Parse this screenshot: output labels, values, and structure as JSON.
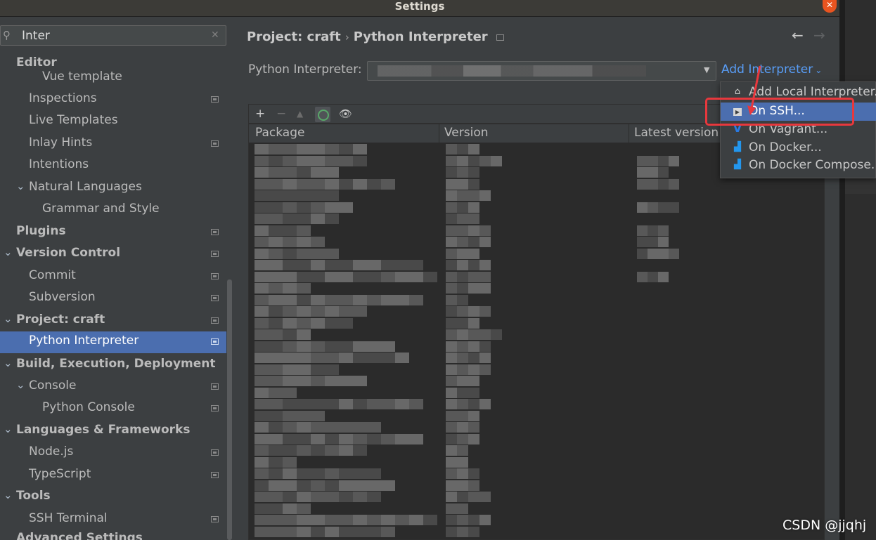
{
  "window": {
    "title": "Settings"
  },
  "search": {
    "value": "Inter"
  },
  "sidebar": {
    "items": [
      {
        "label": "Editor",
        "bold": true
      },
      {
        "label": "Vue template"
      },
      {
        "label": "Inspections"
      },
      {
        "label": "Live Templates"
      },
      {
        "label": "Inlay Hints"
      },
      {
        "label": "Intentions"
      },
      {
        "label": "Natural Languages"
      },
      {
        "label": "Grammar and Style"
      },
      {
        "label": "Plugins",
        "bold": true
      },
      {
        "label": "Version Control",
        "bold": true
      },
      {
        "label": "Commit"
      },
      {
        "label": "Subversion"
      },
      {
        "label": "Project: craft",
        "bold": true
      },
      {
        "label": "Python Interpreter",
        "selected": true
      },
      {
        "label": "Build, Execution, Deployment",
        "bold": true
      },
      {
        "label": "Console"
      },
      {
        "label": "Python Console"
      },
      {
        "label": "Languages & Frameworks",
        "bold": true
      },
      {
        "label": "Node.js"
      },
      {
        "label": "TypeScript"
      },
      {
        "label": "Tools",
        "bold": true
      },
      {
        "label": "SSH Terminal"
      },
      {
        "label": "Advanced Settings",
        "bold": true
      }
    ]
  },
  "breadcrumb": {
    "project": "Project: craft",
    "page": "Python Interpreter"
  },
  "interpreter": {
    "label": "Python Interpreter:",
    "add_label": "Add Interpreter"
  },
  "packages": {
    "columns": [
      "Package",
      "Version",
      "Latest version"
    ]
  },
  "popup": {
    "items": [
      {
        "label": "Add Local Interpreter...",
        "icon": "home-icon"
      },
      {
        "label": "On SSH...",
        "icon": "ssh-icon",
        "highlighted": true
      },
      {
        "label": "On Vagrant...",
        "icon": "vagrant-icon"
      },
      {
        "label": "On Docker...",
        "icon": "docker-icon"
      },
      {
        "label": "On Docker Compose...",
        "icon": "docker-compose-icon"
      }
    ]
  },
  "watermark": "CSDN @jjqhj",
  "colors": {
    "accent": "#4b6eaf",
    "link": "#589df6",
    "annotation": "#e8383d"
  }
}
